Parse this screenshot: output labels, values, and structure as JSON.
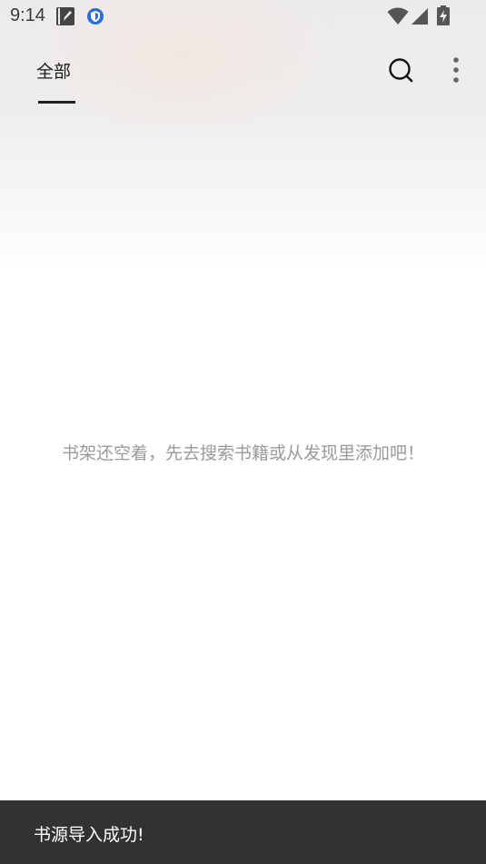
{
  "status_bar": {
    "time": "9:14",
    "icons": [
      "notepad-icon",
      "shield-app-icon",
      "wifi-icon",
      "cellular-signal-icon",
      "battery-charging-icon"
    ]
  },
  "app_bar": {
    "tabs": [
      {
        "label": "全部",
        "selected": true
      }
    ],
    "actions": [
      "search-icon",
      "more-vert-icon"
    ]
  },
  "main": {
    "empty_message": "书架还空着，先去搜索书籍或从发现里添加吧！"
  },
  "toast": {
    "message": "书源导入成功!"
  },
  "colors": {
    "toast_bg": "#323232",
    "empty_text": "#9a9a9a",
    "indicator": "#222222"
  }
}
